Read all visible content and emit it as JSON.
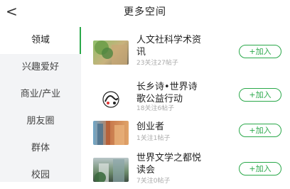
{
  "header": {
    "back_glyph": "<",
    "title": "更多空间"
  },
  "sidebar": {
    "items": [
      {
        "label": "领域",
        "active": true
      },
      {
        "label": "兴趣爱好",
        "active": false
      },
      {
        "label": "商业/产业",
        "active": false
      },
      {
        "label": "朋友圈",
        "active": false
      },
      {
        "label": "群体",
        "active": false
      },
      {
        "label": "校园",
        "active": false
      }
    ]
  },
  "colors": {
    "accent": "#2aa84a",
    "sidebar_bg": "#f3f4f6",
    "meta_text": "#aaaaaa"
  },
  "list": {
    "items": [
      {
        "title_line1": "人文社科学术资",
        "title_line2": "讯",
        "meta": "23关注27帖子",
        "join_label": "+加入"
      },
      {
        "title_line1": "长乡诗•世界诗",
        "title_line2": "歌公益行动",
        "meta": "18关注6帖子",
        "join_label": "+加入"
      },
      {
        "title_line1": "创业者",
        "title_line2": "",
        "meta": "1关注1帖子",
        "join_label": "+加入"
      },
      {
        "title_line1": "世界文学之都悦",
        "title_line2": "读会",
        "meta": "7关注0帖子",
        "join_label": "+加入"
      }
    ]
  }
}
